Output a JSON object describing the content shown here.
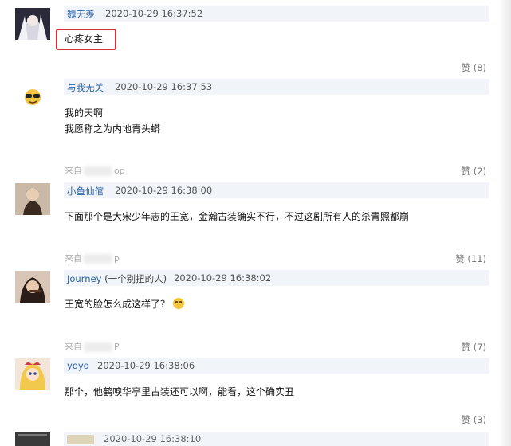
{
  "comments": [
    {
      "username": "魏无羡",
      "time": "2020-10-29 16:37:52",
      "lines": [
        "心疼女主"
      ],
      "source_prefix": "",
      "source_suffix": "",
      "likes": "赞 (8)"
    },
    {
      "username": "与我无关",
      "time": "2020-10-29 16:37:53",
      "lines": [
        "我的天啊",
        "我愿称之为内地青头蟒"
      ],
      "source_prefix": "来自",
      "source_suffix": "op",
      "likes": "赞 (2)"
    },
    {
      "username": "小鱼仙倌",
      "time": "2020-10-29 16:38:00",
      "lines": [
        "下面那个是大宋少年志的王宽，金瀚古装确实不行，不过这剧所有人的杀青照都崩"
      ],
      "source_prefix": "来自",
      "source_suffix": "p",
      "likes": "赞 (11)"
    },
    {
      "username": "Journey",
      "username_note": "(一个别扭的人)",
      "time": "2020-10-29 16:38:02",
      "lines": [
        "王宽的脸怎么成这样了？"
      ],
      "source_prefix": "来自",
      "source_suffix": "P",
      "likes": "赞 (7)"
    },
    {
      "username": "yoyo",
      "time": "2020-10-29 16:38:06",
      "lines": [
        "那个，他鹤唳华亭里古装还可以啊，能看，这个确实丑"
      ],
      "source_prefix": "",
      "source_suffix": "",
      "likes": "赞 (3)"
    },
    {
      "username": "",
      "time": "2020-10-29 16:38:10",
      "lines": [],
      "likes": ""
    }
  ],
  "icons": {
    "highlight_box_color": "#d6303c",
    "username_color": "#2a61a8",
    "header_bg": "#f1f5f9",
    "emoji": "grinning-face-emoji"
  }
}
